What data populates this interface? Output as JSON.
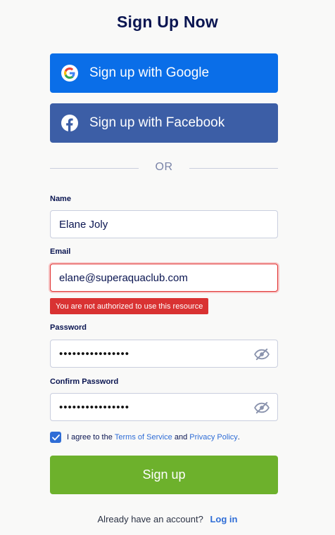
{
  "page": {
    "title": "Sign Up Now"
  },
  "sso": {
    "google_label": "Sign up with Google",
    "facebook_label": "Sign up with Facebook"
  },
  "divider": {
    "text": "OR"
  },
  "form": {
    "name": {
      "label": "Name",
      "value": "Elane Joly"
    },
    "email": {
      "label": "Email",
      "value": "elane@superaquaclub.com",
      "error": "You are not authorized to use this resource"
    },
    "password": {
      "label": "Password",
      "value": "••••••••••••••••"
    },
    "confirm_password": {
      "label": "Confirm Password",
      "value": "••••••••••••••••"
    },
    "agree": {
      "checked": true,
      "prefix": "I agree to the",
      "terms": "Terms of Service",
      "and": "and",
      "privacy": "Privacy Policy",
      "suffix": "."
    },
    "submit_label": "Sign up"
  },
  "footer": {
    "text": "Already have an account?",
    "login_label": "Log in"
  },
  "colors": {
    "google": "#0a6ee8",
    "facebook": "#3c5ea6",
    "submit": "#6db12c",
    "error": "#d93232",
    "link": "#2f6dd6",
    "title": "#0a1551"
  },
  "icons": {
    "google": "google-logo-icon",
    "facebook": "facebook-logo-icon",
    "eye": "eye-slash-icon",
    "check": "checkmark-icon"
  }
}
